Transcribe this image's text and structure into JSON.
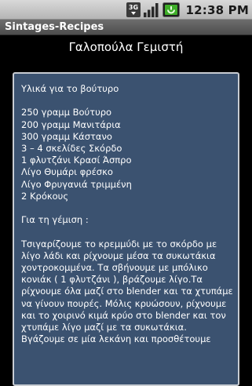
{
  "status_bar": {
    "network_label": "3G",
    "time": "12:38 PM",
    "icons": [
      "3g-icon",
      "signal-icon",
      "battery-icon"
    ]
  },
  "app": {
    "title": "Sintages-Recipes"
  },
  "recipe": {
    "title": "Γαλοπούλα Γεμιστή",
    "body": "Υλικά για το βούτυρο\n\n250 γραμμ Βούτυρο\n200 γραμμ Μανιτάρια\n300 γραμμ Κάστανο\n3 – 4 σκελίδες Σκόρδο\n1 φλυτζάνι Κρασί Άσπρο\nΛίγο Θυμάρι φρέσκο\nΛίγο Φρυγανιά τριμμένη\n2 Κρόκους\n\nΓια τη γέμιση :\n\nΤσιγαρίζουμε το κρεμμύδι με το σκόρδο με λίγο λάδι και ρίχνουμε μέσα τα συκωτάκια χοντροκομμένα. Τα σβήνουμε με μπόλικο κονιάκ ( 1 φλυτζάνι ), βράζουμε λίγο.Τα ρίχνουμε όλα μαζί στο blender και τα χτυπάμε να γίνουν πουρές. Μόλις κρυώσουν, ρίχνουμε και το χοιρινό κιμά κρύο στο blender και τον χτυπάμε λίγο μαζί με τα συκωτάκια. Βγάζουμε σε μία λεκάνη και προσθέτουμε"
  },
  "colors": {
    "status_bar": "#c8c8c8",
    "title_bar": "#5c5c5c",
    "background": "#000000",
    "panel": "#3b5270",
    "panel_border": "#c8ccd2",
    "battery_accent": "#3fae29"
  }
}
